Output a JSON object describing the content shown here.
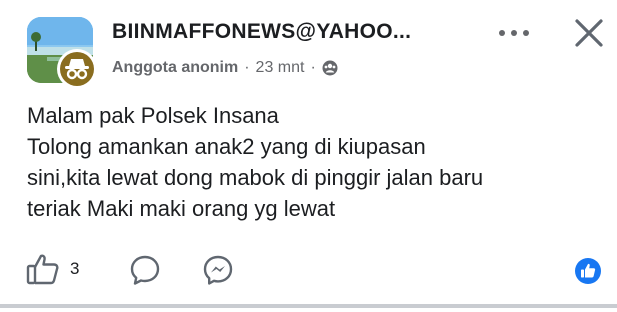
{
  "post": {
    "author": "BIINMAFFONEWS@YAHOO...",
    "role": "Anggota anonim",
    "separator": "·",
    "time": "23 mnt",
    "privacy_icon": "group-privacy-icon",
    "body_lines": [
      "Malam pak Polsek Insana",
      "Tolong amankan anak2 yang di kiupasan",
      "sini,kita lewat dong mabok di pinggir jalan baru",
      "teriak Maki maki orang yg lewat"
    ]
  },
  "header_icons": {
    "more": "more-horizontal-icon",
    "close": "close-icon"
  },
  "actions": {
    "like_icon": "thumbs-up-icon",
    "like_count": "3",
    "comment_icon": "comment-icon",
    "share_icon": "messenger-icon",
    "reaction_icon": "like-reaction-icon"
  },
  "colors": {
    "reaction_blue": "#1877f2",
    "badge_brown": "#8a6d1f",
    "meta_gray": "#65676b"
  }
}
